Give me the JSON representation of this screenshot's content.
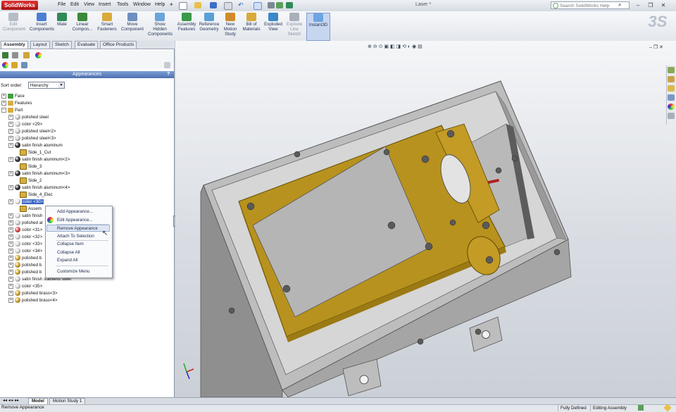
{
  "app": {
    "name": "SolidWorks",
    "document_title": "Laser *"
  },
  "menu": [
    "File",
    "Edit",
    "View",
    "Insert",
    "Tools",
    "Window",
    "Help"
  ],
  "search": {
    "placeholder": "Search SolidWorks Help"
  },
  "toolbar": {
    "commands": [
      {
        "label": "Edit\nComponent",
        "disabled": true
      },
      {
        "label": "Insert\nComponents"
      },
      {
        "label": "Mate"
      },
      {
        "label": "Linear\nCompon..."
      },
      {
        "label": "Smart\nFasteners"
      },
      {
        "label": "Move\nComponent"
      },
      {
        "label": "Show\nHidden\nComponents"
      },
      {
        "label": "Assembly\nFeatures"
      },
      {
        "label": "Reference\nGeometry"
      },
      {
        "label": "New\nMotion\nStudy"
      },
      {
        "label": "Bill of\nMaterials"
      },
      {
        "label": "Exploded\nView"
      },
      {
        "label": "Explode\nLine\nSketch",
        "disabled": true
      },
      {
        "label": "Instant3D",
        "selected": true
      }
    ]
  },
  "tabs": [
    "Assembly",
    "Layout",
    "Sketch",
    "Evaluate",
    "Office Products"
  ],
  "panel": {
    "title": "Appearances",
    "help": "?",
    "sort_label": "Sort order:",
    "sort_value": "Hierarchy"
  },
  "tree": [
    {
      "label": "Face",
      "type": "face"
    },
    {
      "label": "Features",
      "type": "feature"
    },
    {
      "label": "Part",
      "type": "part"
    },
    {
      "label": "polished steel",
      "type": "ball",
      "color": "#c9ccd0"
    },
    {
      "label": "color <29>",
      "type": "ball",
      "color": "#d7d9dc"
    },
    {
      "label": "polished steel<2>",
      "type": "ball",
      "color": "#c9ccd0"
    },
    {
      "label": "polished steel<3>",
      "type": "ball",
      "color": "#c9ccd0"
    },
    {
      "label": "satin finish aluminum",
      "type": "ball",
      "color": "#2c2c2c"
    },
    {
      "label": "Side_1_Cut",
      "type": "child"
    },
    {
      "label": "satin finish aluminum<2>",
      "type": "ball",
      "color": "#2c2c2c"
    },
    {
      "label": "Side_3",
      "type": "child"
    },
    {
      "label": "satin finish aluminum<3>",
      "type": "ball",
      "color": "#2c2c2c"
    },
    {
      "label": "Side_2",
      "type": "child"
    },
    {
      "label": "satin finish aluminum<4>",
      "type": "ball",
      "color": "#2c2c2c"
    },
    {
      "label": "Side_4_Elec",
      "type": "child"
    },
    {
      "label": "color <30>",
      "type": "ball",
      "color": "#e4e4e4",
      "selected": true
    },
    {
      "label": "Assem",
      "type": "child"
    },
    {
      "label": "satin finish",
      "type": "ball",
      "color": "#e2e2e2"
    },
    {
      "label": "polished al",
      "type": "ball",
      "color": "#cfd2d6"
    },
    {
      "label": "color <31>",
      "type": "ball",
      "color": "#e04747"
    },
    {
      "label": "color <32>",
      "type": "ball",
      "color": "#dadada"
    },
    {
      "label": "color <33>",
      "type": "ball",
      "color": "#dadada"
    },
    {
      "label": "color <34>",
      "type": "ball",
      "color": "#dadada"
    },
    {
      "label": "polished b",
      "type": "ball",
      "color": "#d4a72c"
    },
    {
      "label": "polished b",
      "type": "ball",
      "color": "#d4a72c"
    },
    {
      "label": "polished b",
      "type": "ball",
      "color": "#d4a72c"
    },
    {
      "label": "satin finish stainless steel",
      "type": "ball",
      "color": "#d0d0d0"
    },
    {
      "label": "color <35>",
      "type": "ball",
      "color": "#dadada"
    },
    {
      "label": "polished brass<3>",
      "type": "ball",
      "color": "#d4a72c"
    },
    {
      "label": "polished brass<4>",
      "type": "ball",
      "color": "#d4a72c"
    }
  ],
  "context_menu": [
    "Add Appearance...",
    "Edit Appearance...",
    "Remove Appearance",
    "Attach To Selection",
    "Collapse Item",
    "Collapse All",
    "Expand All",
    "Customize Menu"
  ],
  "bottom_tabs": [
    "Model",
    "Motion Study 1"
  ],
  "status": {
    "message": "Remove Appearance",
    "defined": "Fully Defined",
    "mode": "Editing Assembly"
  },
  "colors": {
    "accent": "#3966c6",
    "brass": "#b08b1a",
    "housing": "#a8a8a8"
  }
}
